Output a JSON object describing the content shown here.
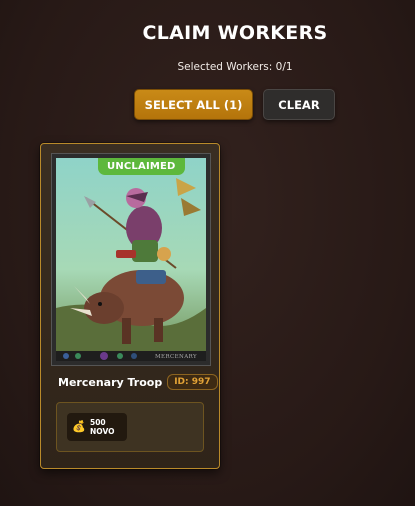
{
  "header": {
    "title": "CLAIM WORKERS",
    "selected_text": "Selected Workers: 0/1"
  },
  "actions": {
    "select_all_label": "SELECT ALL (1)",
    "clear_label": "CLEAR"
  },
  "colors": {
    "accent_gold": "#c98a17",
    "badge_green": "#5db83c",
    "id_orange": "#e2a236"
  },
  "workers": [
    {
      "status": "UNCLAIMED",
      "name": "Mercenary Troop",
      "id_label": "ID: 997",
      "card_caption": "MERCENARY",
      "reward_icon": "money-bag-icon",
      "reward_amount": "500",
      "reward_currency": "NOVO"
    }
  ]
}
